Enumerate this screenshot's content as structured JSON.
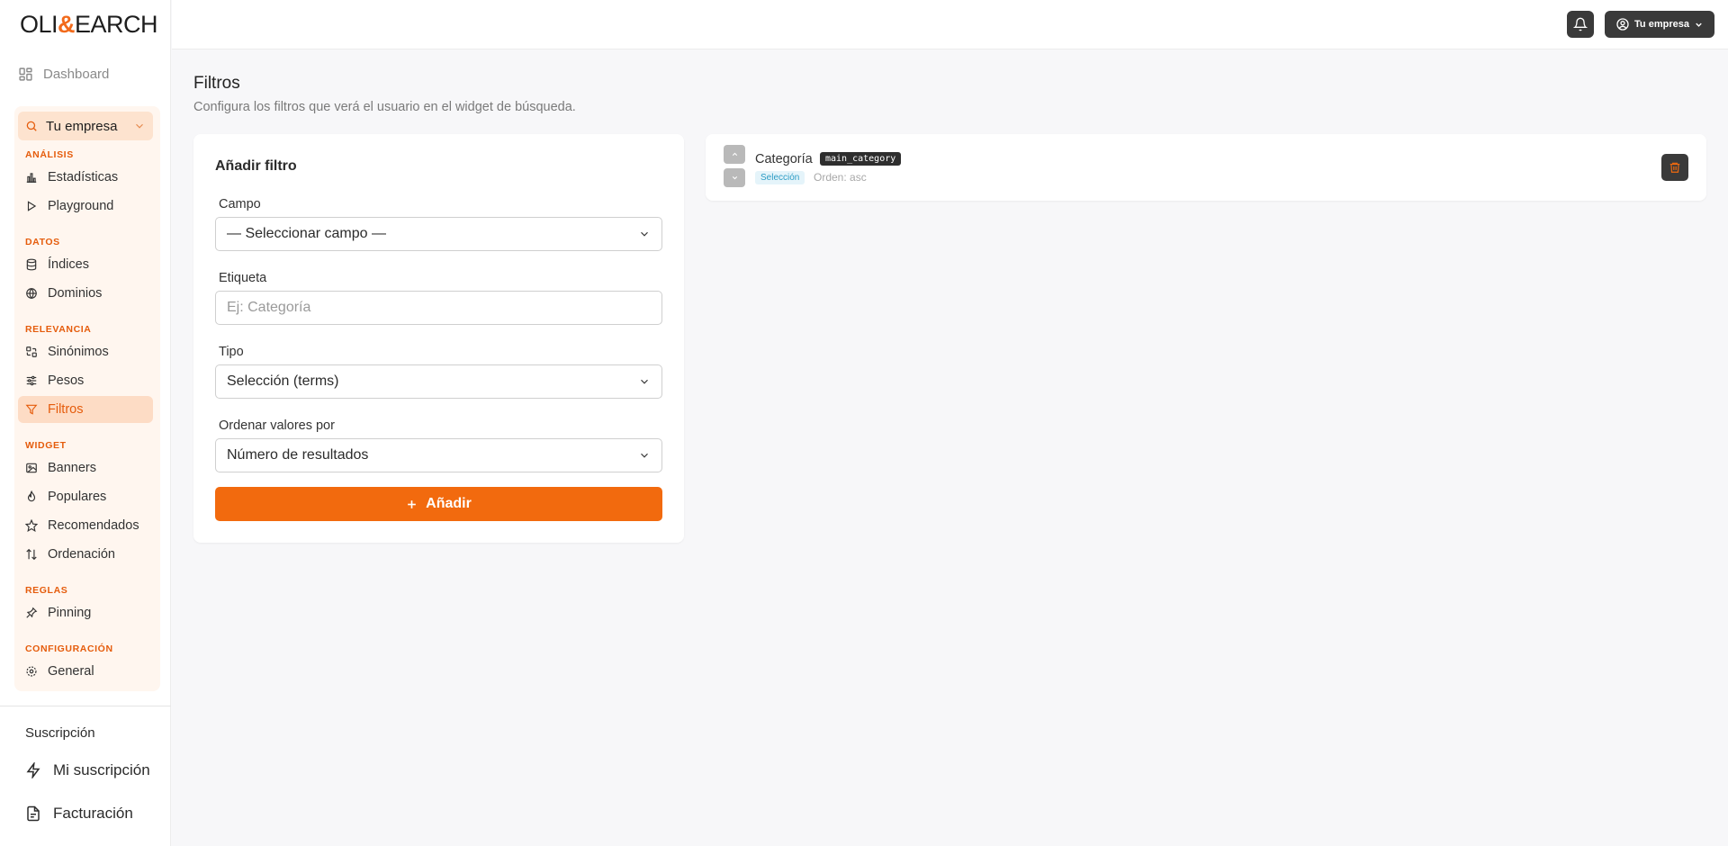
{
  "brand": {
    "logo_prefix": "OLI",
    "logo_amp": "&",
    "logo_suffix": "EARCH"
  },
  "sidebar": {
    "dashboard_label": "Dashboard",
    "company_selector": "Tu empresa",
    "sections": [
      {
        "title": "ANÁLISIS",
        "items": [
          {
            "label": "Estadísticas",
            "icon": "bar-chart-icon"
          },
          {
            "label": "Playground",
            "icon": "play-icon"
          }
        ]
      },
      {
        "title": "DATOS",
        "items": [
          {
            "label": "Índices",
            "icon": "database-icon"
          },
          {
            "label": "Dominios",
            "icon": "globe-icon"
          }
        ]
      },
      {
        "title": "RELEVANCIA",
        "items": [
          {
            "label": "Sinónimos",
            "icon": "synonyms-icon"
          },
          {
            "label": "Pesos",
            "icon": "sliders-icon"
          },
          {
            "label": "Filtros",
            "icon": "filter-icon",
            "active": true
          }
        ]
      },
      {
        "title": "WIDGET",
        "items": [
          {
            "label": "Banners",
            "icon": "image-icon"
          },
          {
            "label": "Populares",
            "icon": "flame-icon"
          },
          {
            "label": "Recomendados",
            "icon": "star-icon"
          },
          {
            "label": "Ordenación",
            "icon": "sort-icon"
          }
        ]
      },
      {
        "title": "REGLAS",
        "items": [
          {
            "label": "Pinning",
            "icon": "pin-icon"
          }
        ]
      },
      {
        "title": "CONFIGURACIÓN",
        "items": [
          {
            "label": "General",
            "icon": "gear-icon"
          }
        ]
      }
    ],
    "subscription": {
      "title": "Suscripción",
      "my_subscription": "Mi suscripción",
      "billing": "Facturación"
    }
  },
  "header": {
    "account_label": "Tu empresa"
  },
  "page": {
    "title": "Filtros",
    "subtitle": "Configura los filtros que verá el usuario en el widget de búsqueda."
  },
  "add_filter": {
    "title": "Añadir filtro",
    "field_label": "Campo",
    "field_value": "— Seleccionar campo —",
    "tag_label": "Etiqueta",
    "tag_placeholder": "Ej: Categoría",
    "type_label": "Tipo",
    "type_value": "Selección (terms)",
    "order_label": "Ordenar valores por",
    "order_value": "Número de resultados",
    "submit_label": "Añadir"
  },
  "filters": [
    {
      "name": "Categoría",
      "field": "main_category",
      "type": "Selección",
      "order": "Orden: asc"
    }
  ],
  "colors": {
    "accent": "#f26a0e",
    "accent_light": "#fff6ef",
    "dark_button": "#3a3a3a"
  }
}
